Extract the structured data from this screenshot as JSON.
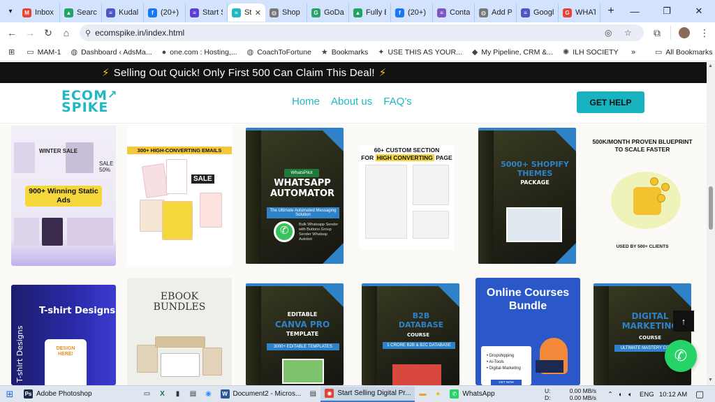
{
  "browser": {
    "tabs": [
      {
        "label": "Inbox",
        "icon": "gmail-icon",
        "color": "#ea4335",
        "glyph": "M"
      },
      {
        "label": "Search",
        "icon": "drive-icon",
        "color": "#1fa463",
        "glyph": "▲"
      },
      {
        "label": "Kudal",
        "icon": "forms-icon",
        "color": "#4b58c4",
        "glyph": "≡"
      },
      {
        "label": "(20+)",
        "icon": "facebook-icon",
        "color": "#1877f2",
        "glyph": "f"
      },
      {
        "label": "Start S",
        "icon": "forms-icon",
        "color": "#5e3fd6",
        "glyph": "≡"
      },
      {
        "label": "Shop",
        "icon": "globe-icon",
        "color": "#777777",
        "glyph": "◍"
      },
      {
        "label": "GoDa",
        "icon": "godaddy-icon",
        "color": "#29a36a",
        "glyph": "G"
      },
      {
        "label": "Fully E",
        "icon": "drive-icon",
        "color": "#1fa463",
        "glyph": "▲"
      },
      {
        "label": "(20+)",
        "icon": "facebook-icon",
        "color": "#1877f2",
        "glyph": "f"
      },
      {
        "label": "Conta",
        "icon": "forms-icon",
        "color": "#7e57c2",
        "glyph": "≡"
      },
      {
        "label": "Add P",
        "icon": "globe-icon",
        "color": "#777777",
        "glyph": "◍"
      },
      {
        "label": "Googl",
        "icon": "slides-icon",
        "color": "#4b58c4",
        "glyph": "≡"
      },
      {
        "label": "WHAT",
        "icon": "google-icon",
        "color": "#ea4335",
        "glyph": "G"
      }
    ],
    "active_tab": {
      "label": "St",
      "icon": "ecomspike-icon",
      "color": "#21b7c4",
      "glyph": "≈"
    },
    "url": "ecomspike.in/index.html",
    "bookmarks": [
      {
        "label": "MAM-1",
        "icon": "folder-icon",
        "glyph": "▭"
      },
      {
        "label": "Dashboard ‹ AdsMa...",
        "icon": "globe-icon",
        "glyph": "◍"
      },
      {
        "label": "one.com : Hosting,...",
        "icon": "onecom-icon",
        "glyph": "●"
      },
      {
        "label": "CoachToFortune",
        "icon": "globe-icon",
        "glyph": "◍"
      },
      {
        "label": "Bookmarks",
        "icon": "star-icon",
        "glyph": "★"
      },
      {
        "label": "USE THIS AS YOUR...",
        "icon": "bookmark-icon",
        "glyph": "✦"
      },
      {
        "label": "My Pipeline, CRM &...",
        "icon": "pipeline-icon",
        "glyph": "◆"
      },
      {
        "label": "ILH SOCIETY",
        "icon": "ilh-icon",
        "glyph": "✺"
      }
    ],
    "all_bookmarks": "All Bookmarks"
  },
  "site": {
    "promo": "Selling Out Quick! Only First 500 Can Claim This Deal!",
    "logo_line1": "ECOM",
    "logo_line2": "SPIKE",
    "nav": [
      "Home",
      "About us",
      "FAQ’s"
    ],
    "help_button": "GET HELP"
  },
  "products": {
    "p1": {
      "top": "WINTER SALE",
      "sale": "SALE 50%",
      "banner": "900+ Winning Static Ads"
    },
    "p2": {
      "head": "300+ HIGH-CONVERTING EMAILS",
      "sale": "SALE"
    },
    "p3": {
      "brand": "WhatsPilot",
      "title": "WHATSAPP AUTOMATOR",
      "sub": "The Ultimate Automated Messaging Solution",
      "desc": "Bulk Whatsapp Sender with Buttons Group Sender Whatsap Autobot"
    },
    "p4": {
      "head1": "60+ CUSTOM SECTION",
      "head2a": "FOR ",
      "head2b": "HIGH CONVERTING",
      "head2c": " PAGE"
    },
    "p5": {
      "title": "5000+ SHOPIFY THEMES",
      "sub": "PACKAGE"
    },
    "p6": {
      "head": "500K/MONTH PROVEN BLUEPRINT TO SCALE FASTER",
      "foot": "USED BY 500+ CLIENTS"
    },
    "p7": {
      "title": "T-shirt Designs",
      "side": "T-shirt Designs",
      "shirt": "DESIGN HERE!"
    },
    "p8": {
      "title": "EBOOK BUNDLES"
    },
    "p9": {
      "top": "EDITABLE",
      "title": "CANVA PRO",
      "sub": "TEMPLATE",
      "band": "3000+ EDITABLE TEMPLATES"
    },
    "p10": {
      "title": "B2B DATABASE",
      "sub": "COURSE",
      "band": "1 CRORE B2B & B2C DATABASE"
    },
    "p11": {
      "title": "Online Courses Bundle",
      "items": [
        "Dropshipping",
        "Ai-Tools",
        "Digital-Marketing"
      ],
      "cta": "GET NOW"
    },
    "p12": {
      "title": "DIGITAL MARKETING",
      "sub": "COURSE",
      "band": "ULTIMATE MASTERY COURSE"
    }
  },
  "taskbar": {
    "apps": [
      {
        "label": "Adobe Photoshop",
        "icon": "photoshop-icon",
        "color": "#1a2b4c",
        "glyph": "Ps"
      },
      {
        "label": "Document2 - Micros...",
        "icon": "word-icon",
        "color": "#2b579a",
        "glyph": "W"
      },
      {
        "label": "Start Selling Digital Pr...",
        "icon": "chrome-icon",
        "color": "#db4437",
        "glyph": "◉"
      },
      {
        "label": "WhatsApp",
        "icon": "whatsapp-icon",
        "color": "#25d366",
        "glyph": "✆"
      }
    ],
    "net_up_label": "U:",
    "net_down_label": "D:",
    "net_up": "0.00 MB/s",
    "net_down": "0.00 MB/s",
    "lang": "ENG",
    "time": "10:12 AM"
  }
}
